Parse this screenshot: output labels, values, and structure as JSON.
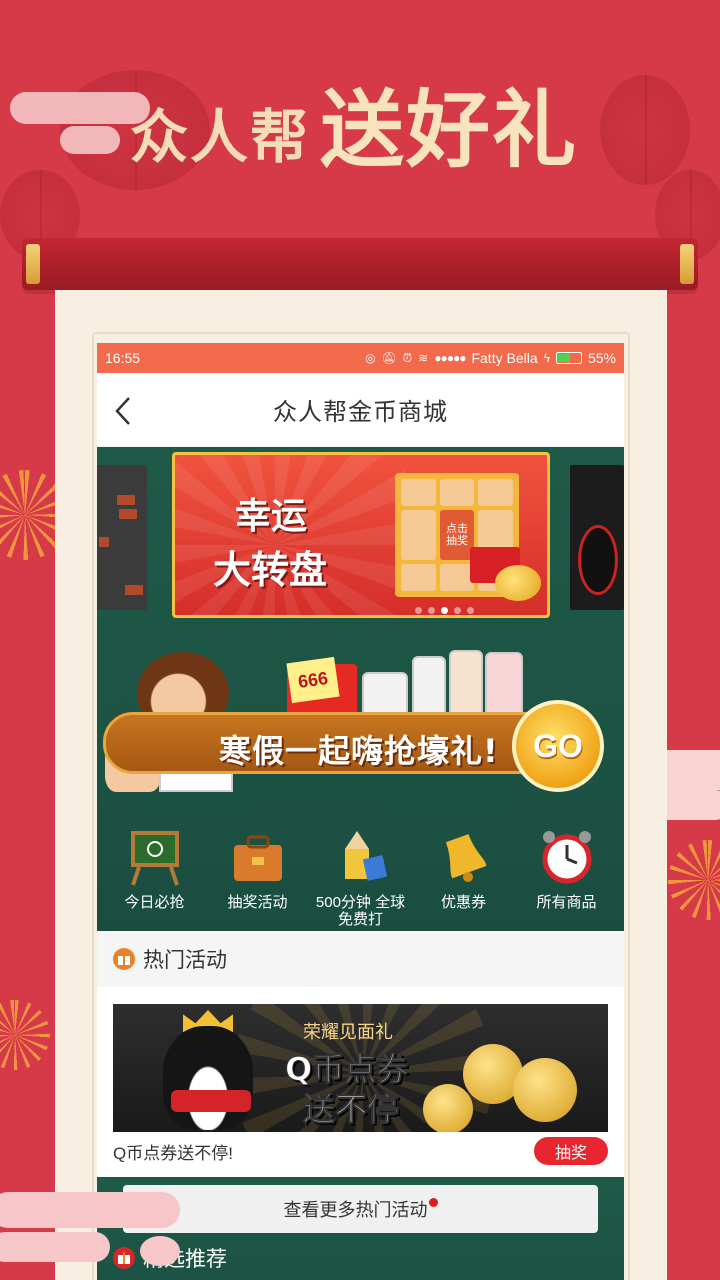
{
  "promo": {
    "headline_small": "众人帮",
    "headline_big": "送好礼"
  },
  "status_bar": {
    "time": "16:55",
    "signal_dots": "●●●●●",
    "carrier": "Fatty Bella",
    "battery_percent": "55%",
    "battery_level": 0.55
  },
  "nav": {
    "title": "众人帮金币商城"
  },
  "carousel": {
    "banner_title_line1": "幸运",
    "banner_title_line2": "大转盘",
    "wheel_center": "点击\n抽奖",
    "slide_count": 5,
    "active_slide": 2
  },
  "event_banner": {
    "packet_amount": "666",
    "slogan": "寒假一起嗨抢壕礼!",
    "go_label": "GO"
  },
  "quick_links": [
    {
      "label": "今日必抢",
      "icon": "chalkboard-icon"
    },
    {
      "label": "抽奖活动",
      "icon": "briefcase-icon"
    },
    {
      "label": "500分钟 全球免费打",
      "icon": "pencil-icon"
    },
    {
      "label": "优惠券",
      "icon": "bell-icon"
    },
    {
      "label": "所有商品",
      "icon": "alarm-clock-icon"
    }
  ],
  "hot_section": {
    "title": "热门活动",
    "card": {
      "image_line1": "荣耀见面礼",
      "image_line2": "Q币点券",
      "image_line3": "送不停",
      "caption": "Q币点券送不停!",
      "action_label": "抽奖"
    },
    "more_label": "查看更多热门活动"
  },
  "featured_section": {
    "title": "精选推荐"
  },
  "colors": {
    "background": "#d63a48",
    "status_bar": "#f26a4b",
    "board_green": "#1f5a49",
    "accent_red": "#e7262f",
    "gold": "#f7e3bc"
  }
}
